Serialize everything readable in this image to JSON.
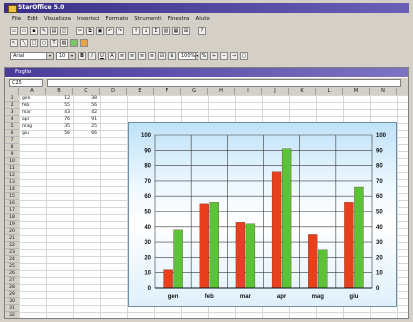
{
  "window": {
    "title": "StarOffice 5.0"
  },
  "menu": [
    "File",
    "Edit",
    "Visualizza",
    "Inserisci",
    "Formato",
    "Strumenti",
    "Finestra",
    "Aiuto"
  ],
  "toolbar": {
    "font_name": "Arial",
    "font_size": "10",
    "zoom": "100%"
  },
  "document": {
    "title": "Foglio",
    "cell_ref": "C25"
  },
  "columns": [
    "A",
    "B",
    "C",
    "D",
    "E",
    "F",
    "G",
    "H",
    "I",
    "J",
    "K",
    "L",
    "M",
    "N",
    "O"
  ],
  "sheet_rows": [
    {
      "label": "gen",
      "b": "12",
      "c": "38"
    },
    {
      "label": "feb",
      "b": "55",
      "c": "56"
    },
    {
      "label": "mar",
      "b": "43",
      "c": "42"
    },
    {
      "label": "apr",
      "b": "76",
      "c": "91"
    },
    {
      "label": "mag",
      "b": "35",
      "c": "25"
    },
    {
      "label": "giu",
      "b": "56",
      "c": "66"
    }
  ],
  "row_count": 32,
  "chart_data": {
    "type": "bar",
    "categories": [
      "gen",
      "feb",
      "mar",
      "apr",
      "mag",
      "giu"
    ],
    "series": [
      {
        "values": [
          12,
          55,
          43,
          76,
          35,
          56
        ],
        "color": "#e8401c"
      },
      {
        "values": [
          38,
          56,
          42,
          91,
          25,
          66
        ],
        "color": "#5cc238"
      }
    ],
    "ylim": [
      0,
      100
    ],
    "yticks": [
      0,
      10,
      20,
      30,
      40,
      50,
      60,
      70,
      80,
      90,
      100
    ],
    "grid": true,
    "right_axis": true
  }
}
